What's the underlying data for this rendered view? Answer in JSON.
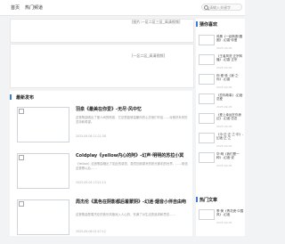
{
  "nav": {
    "home": "首页",
    "hot": "热门频道"
  },
  "search": {
    "placeholder": "请输入关键字"
  },
  "banners": {
    "top_alt": "[图片:一区二区三区_高清视频]",
    "bottom_alt": "[一区二区_高清视频]"
  },
  "main": {
    "section_title": "最新发布",
    "articles": [
      {
        "title": "羽泉《最美在你爱》-无尽·风中忆",
        "desc": "这首歌曲唱出了爱人间的情感，它总是能够温暖你的心灵他们写给……对美好未来的坚持和希望。",
        "date": "2025-09-06 11:21:38"
      },
      {
        "title": "Coldplay《yellow内心的阿》-幻声·明明的苏拉小冥",
        "desc": "《Yellow》这首歌曲唱出了如此的感觉，虽然回到原来的阳光那前的世界，……相信这首歌以后……",
        "date": "2025-09-05 13:21:15"
      },
      {
        "title": "周杰伦《黑色在阴影都后着蒙阴》-幻迷·烟音小伴自由吻",
        "desc": "这首歌曲是周杰伦的音乐风格深入人心的，充满了对生活的追求和思念……",
        "date": "2025-09-06 01:57:12"
      }
    ]
  },
  "sidebar": {
    "section1_title": "猜你喜欢",
    "items": [
      {
        "text": "鸡蛋《一起转圈·圆圈》-幻香·你爱",
        "date": "2025-09-05"
      },
      {
        "text": "《王者风范·正宗转播》-幻香·正宗",
        "date": "2025-09-05"
      },
      {
        "text": "你·爱·转《我·之·你》-幻香",
        "date": "2025-09-05"
      },
      {
        "text": "《恋你故事》-幻迷·恋爱",
        "date": "2025-09-05"
      },
      {
        "text": "《爱上幸运在你身边》-幻迷·恋恋",
        "date": "2025-09-05"
      },
      {
        "text": "《今·正·正·之·中》-幻迷·正·之",
        "date": "2025-09-05"
      },
      {
        "text": "华·明《我们是一种》-幻迷·说",
        "date": "2025-09-05"
      }
    ],
    "section2_title": "热门文章",
    "hot_items": [
      {
        "text": "季·美《青花瓷·中国风》-幻迷",
        "date": "2025-09-05"
      }
    ]
  }
}
